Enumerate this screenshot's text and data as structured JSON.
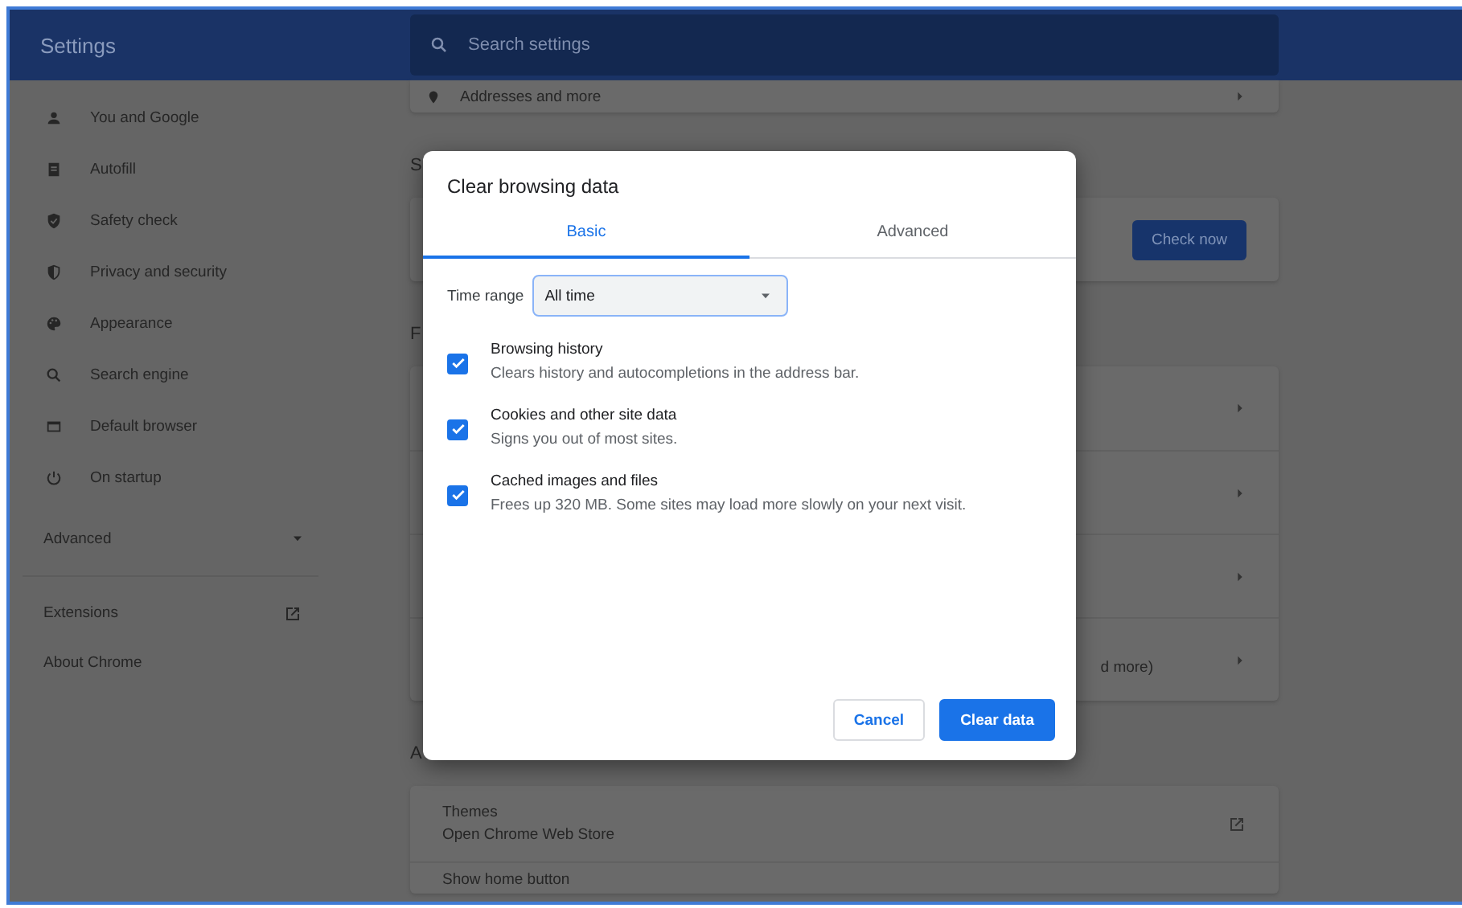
{
  "header": {
    "title": "Settings",
    "search": {
      "placeholder": "Search settings"
    }
  },
  "sidebar": {
    "items": [
      {
        "label": "You and Google"
      },
      {
        "label": "Autofill"
      },
      {
        "label": "Safety check"
      },
      {
        "label": "Privacy and security"
      },
      {
        "label": "Appearance"
      },
      {
        "label": "Search engine"
      },
      {
        "label": "Default browser"
      },
      {
        "label": "On startup"
      }
    ],
    "advanced": {
      "label": "Advanced",
      "expanded": false
    },
    "links": [
      {
        "label": "Extensions",
        "external": true
      },
      {
        "label": "About Chrome",
        "external": false
      }
    ]
  },
  "content": {
    "sections": [
      {
        "rows": [
          {
            "kind": "plain",
            "text": "Addresses and more",
            "chevron": true
          }
        ]
      },
      {
        "heading": "S",
        "rows": [
          {
            "kind": "plain",
            "button": "Check now"
          }
        ]
      },
      {
        "heading": "F",
        "rows": [
          {
            "kind": "plain",
            "chevron": true
          },
          {
            "kind": "plain",
            "chevron": true
          },
          {
            "kind": "plain",
            "chevron": true
          },
          {
            "kind": "tail",
            "text": "d more)",
            "chevron": true
          }
        ]
      },
      {
        "heading": "A",
        "rows": [
          {
            "kind": "plain",
            "text": "Themes",
            "subtext": "Open Chrome Web Store",
            "external": true
          },
          {
            "kind": "plain",
            "text": "Show home button"
          }
        ]
      }
    ]
  },
  "dialog": {
    "title": "Clear browsing data",
    "tabs": [
      {
        "label": "Basic",
        "selected": true
      },
      {
        "label": "Advanced",
        "selected": false
      }
    ],
    "time_range": {
      "label": "Time range",
      "value": "All time"
    },
    "options": [
      {
        "label": "Browsing history",
        "description": "Clears history and autocompletions in the address bar.",
        "checked": true
      },
      {
        "label": "Cookies and other site data",
        "description": "Signs you out of most sites.",
        "checked": true
      },
      {
        "label": "Cached images and files",
        "description": "Frees up 320 MB. Some sites may load more slowly on your next visit.",
        "checked": true
      }
    ],
    "buttons": [
      {
        "label": "Cancel",
        "kind": "secondary"
      },
      {
        "label": "Clear data",
        "kind": "primary"
      }
    ]
  }
}
